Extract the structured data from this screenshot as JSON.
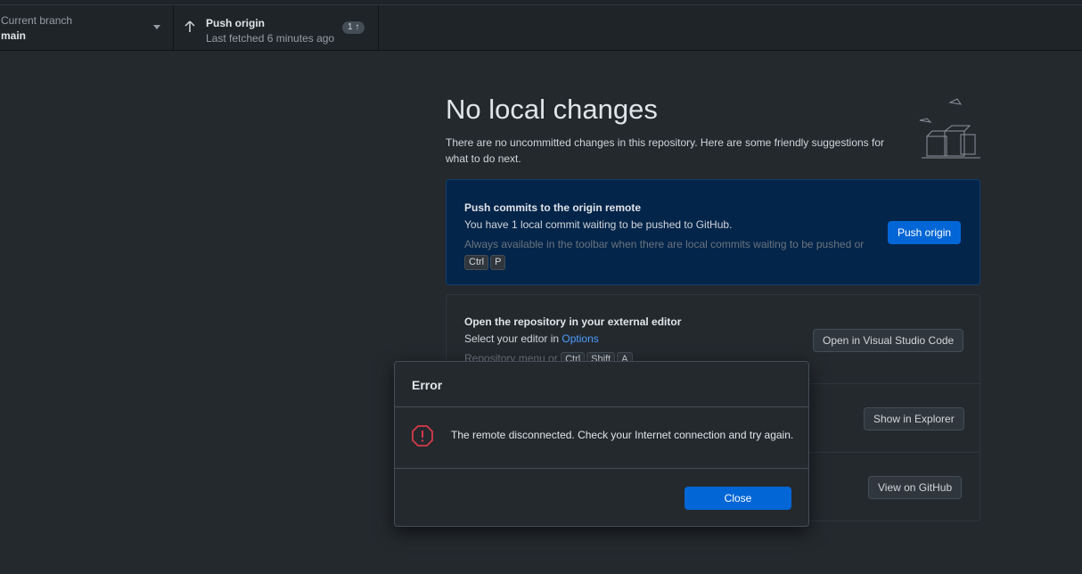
{
  "toolbar": {
    "branch_label": "Current branch",
    "branch_name": "main",
    "push_title": "Push origin",
    "push_subtitle": "Last fetched 6 minutes ago",
    "push_badge": "1 ↑"
  },
  "main": {
    "title": "No local changes",
    "subtitle": "There are no uncommitted changes in this repository. Here are some friendly suggestions for what to do next."
  },
  "cards": {
    "push": {
      "title": "Push commits to the origin remote",
      "desc": "You have 1 local commit waiting to be pushed to GitHub.",
      "hint": "Always available in the toolbar when there are local commits waiting to be pushed or",
      "keys": [
        "Ctrl",
        "P"
      ],
      "button": "Push origin"
    },
    "editor": {
      "title": "Open the repository in your external editor",
      "desc_prefix": "Select your editor in",
      "desc_link": "Options",
      "hint": "Repository menu or",
      "keys": [
        "Ctrl",
        "Shift",
        "A"
      ],
      "button": "Open in Visual Studio Code"
    },
    "explorer": {
      "button": "Show in Explorer"
    },
    "github": {
      "button": "View on GitHub"
    }
  },
  "dialog": {
    "title": "Error",
    "message": "The remote disconnected. Check your Internet connection and try again.",
    "close_label": "Close"
  },
  "colors": {
    "accent": "#0366d6",
    "error": "#d73a49",
    "background": "#24292e"
  }
}
